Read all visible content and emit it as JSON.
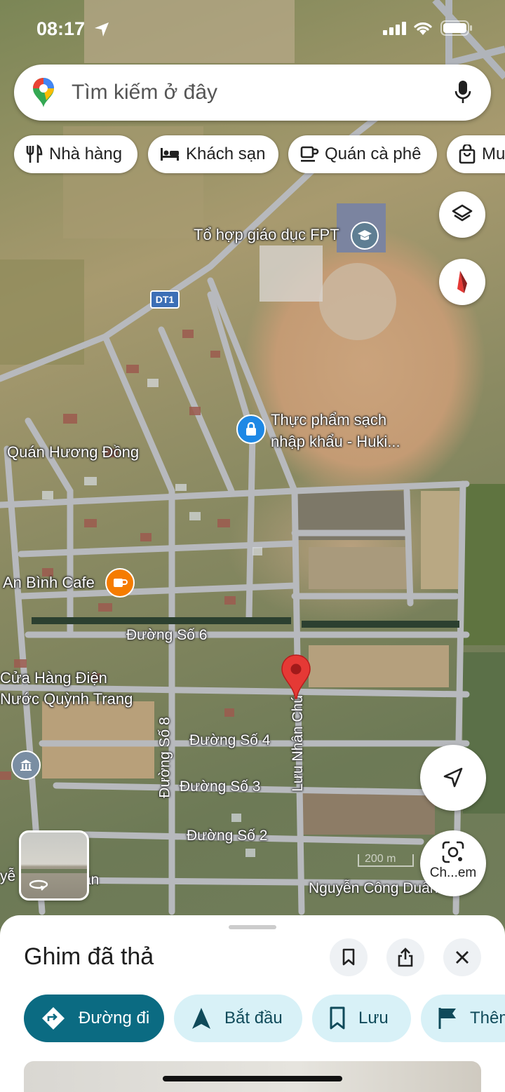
{
  "status_bar": {
    "time": "08:17"
  },
  "search": {
    "placeholder": "Tìm kiếm ở đây"
  },
  "chips": [
    {
      "label": "Nhà hàng",
      "icon": "restaurant-icon"
    },
    {
      "label": "Khách sạn",
      "icon": "hotel-icon"
    },
    {
      "label": "Quán cà phê",
      "icon": "coffee-icon"
    },
    {
      "label": "Mu",
      "icon": "shopping-bag-icon"
    }
  ],
  "map": {
    "road_badge": "DT1",
    "places": {
      "fpt": "Tổ hợp giáo dục FPT",
      "food_line1": "Thực phẩm sạch",
      "food_line2": "nhập khẩu - Huki...",
      "huong_dong": "Quán Hương Đồng",
      "an_binh": "An Bình Cafe",
      "quynh_line1": "Cửa Hàng Điện",
      "quynh_line2": "Nước Quỳnh Trang"
    },
    "streets": {
      "so6": "Đường Số 6",
      "so4": "Đường Số 4",
      "so3": "Đường Số 3",
      "so2": "Đường Số 2",
      "so8": "Đường Số 8",
      "luu_nhan_chu": "Lưu Nhân Chú",
      "nguyen_cong_duan": "Nguyễn Công Duẩn",
      "partial_left": "yễ",
      "partial_right": "ẫn"
    },
    "scale_label": "200 m",
    "lens_label": "Ch...em"
  },
  "sheet": {
    "title": "Ghim đã thả",
    "actions": [
      {
        "label": "Đường đi",
        "icon": "directions-icon"
      },
      {
        "label": "Bắt đầu",
        "icon": "navigation-arrow-icon"
      },
      {
        "label": "Lưu",
        "icon": "bookmark-icon"
      },
      {
        "label": "Thêm",
        "icon": "flag-icon"
      }
    ]
  },
  "colors": {
    "accent": "#0b6b82",
    "chip_bg": "#d8f1f7",
    "pin": "#e53935"
  }
}
